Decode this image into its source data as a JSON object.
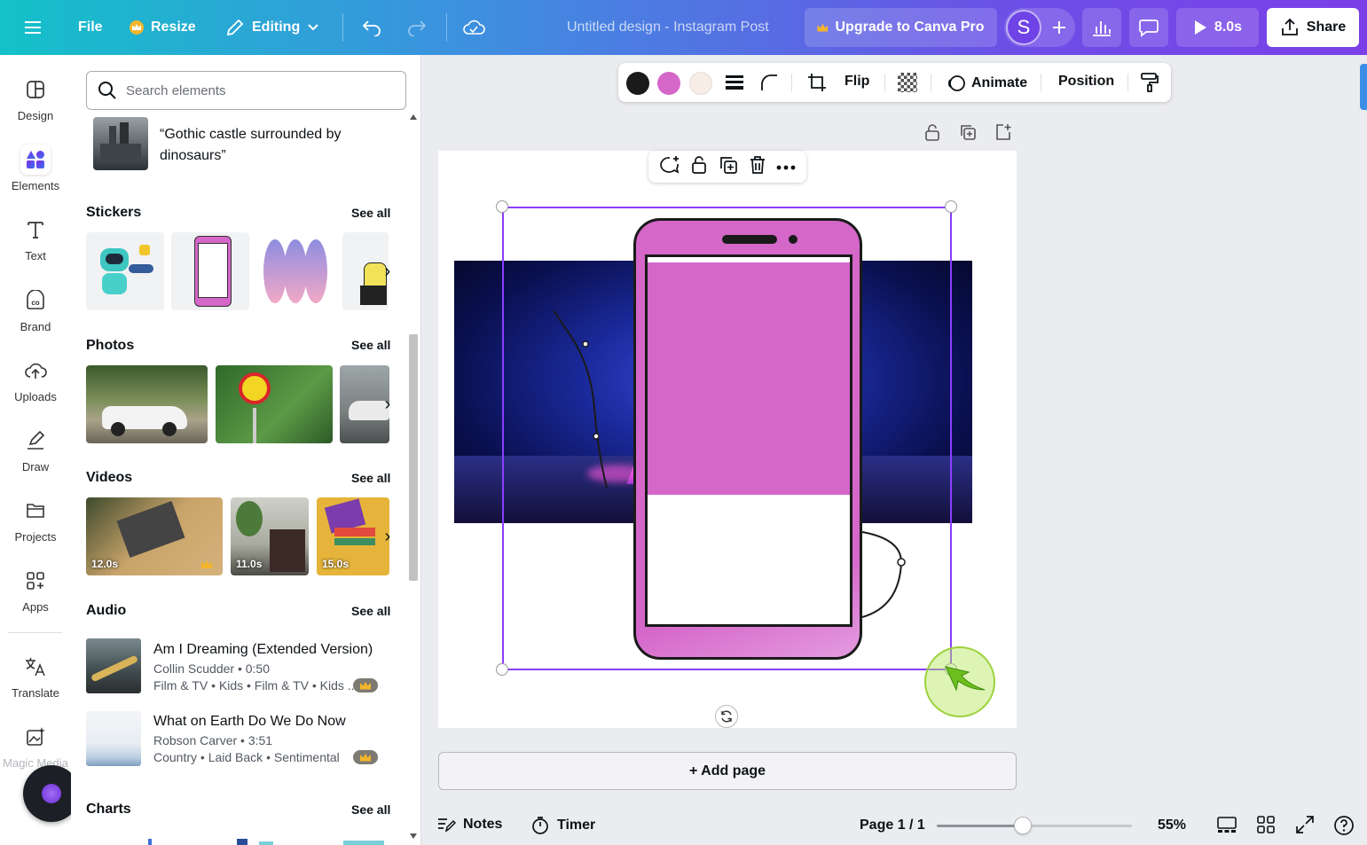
{
  "topbar": {
    "file_label": "File",
    "resize_label": "Resize",
    "editing_label": "Editing",
    "doc_title": "Untitled design - Instagram Post",
    "upgrade_label": "Upgrade to Canva Pro",
    "avatar_letter": "S",
    "play_duration": "8.0s",
    "share_label": "Share"
  },
  "rail": {
    "items": [
      {
        "label": "Design",
        "icon": "design-icon"
      },
      {
        "label": "Elements",
        "icon": "elements-icon"
      },
      {
        "label": "Text",
        "icon": "text-icon"
      },
      {
        "label": "Brand",
        "icon": "brand-icon"
      },
      {
        "label": "Uploads",
        "icon": "upload-icon"
      },
      {
        "label": "Draw",
        "icon": "draw-icon"
      },
      {
        "label": "Projects",
        "icon": "folder-icon"
      },
      {
        "label": "Apps",
        "icon": "apps-icon"
      },
      {
        "label": "Translate",
        "icon": "translate-icon"
      },
      {
        "label": "Magic Media",
        "icon": "magic-media-icon"
      }
    ]
  },
  "panel": {
    "search_placeholder": "Search elements",
    "suggestion": "“Gothic castle surrounded by dinosaurs”",
    "see_all": "See all",
    "sections": {
      "stickers": "Stickers",
      "photos": "Photos",
      "videos": "Videos",
      "audio": "Audio",
      "charts": "Charts"
    },
    "videos": [
      {
        "duration": "12.0s"
      },
      {
        "duration": "11.0s"
      },
      {
        "duration": "15.0s"
      }
    ],
    "audio": [
      {
        "title": "Am I Dreaming (Extended Version)",
        "artist": "Collin Scudder • 0:50",
        "tags": "Film & TV • Kids • Film & TV • Kids ..."
      },
      {
        "title": "What on Earth Do We Do Now",
        "artist": "Robson Carver • 3:51",
        "tags": "Country • Laid Back • Sentimental"
      }
    ]
  },
  "context_toolbar": {
    "colors": [
      "#1a1a1a",
      "#d567c9",
      "#f7ede6"
    ],
    "flip_label": "Flip",
    "animate_label": "Animate",
    "position_label": "Position"
  },
  "bottombar": {
    "add_page_label": "+ Add page",
    "notes_label": "Notes",
    "timer_label": "Timer",
    "page_indicator": "Page 1 / 1",
    "zoom_percent": "55%",
    "zoom_fraction": 0.44
  }
}
